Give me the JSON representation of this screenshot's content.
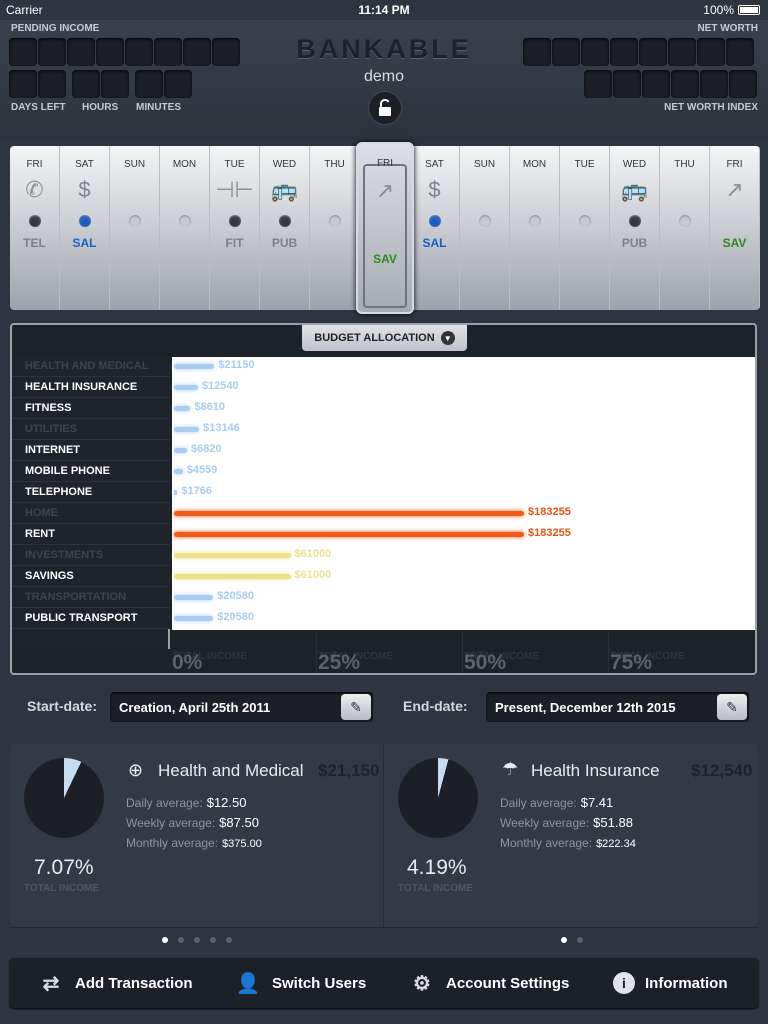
{
  "statusbar": {
    "carrier": "Carrier",
    "time": "11:14 PM",
    "battery": "100%"
  },
  "header": {
    "pending_income_label": "PENDING INCOME",
    "net_worth_label": "NET WORTH",
    "days_left_label": "DAYS LEFT",
    "hours_label": "HOURS",
    "minutes_label": "MINUTES",
    "net_worth_index_label": "NET WORTH INDEX",
    "brand": "BANKABLE",
    "user": "demo"
  },
  "calendar": {
    "days": [
      {
        "name": "FRI",
        "icon": "phone-icon",
        "glyph": "✆",
        "dot": "dark",
        "code": "TEL",
        "code_color": "gray"
      },
      {
        "name": "SAT",
        "icon": "dollar-icon",
        "glyph": "$",
        "dot": "blue",
        "code": "SAL",
        "code_color": "blue"
      },
      {
        "name": "SUN",
        "icon": "",
        "glyph": "",
        "dot": "light",
        "code": "",
        "code_color": "gray"
      },
      {
        "name": "MON",
        "icon": "",
        "glyph": "",
        "dot": "light",
        "code": "",
        "code_color": "gray"
      },
      {
        "name": "TUE",
        "icon": "dumbbell-icon",
        "glyph": "⊣⊢",
        "dot": "dark",
        "code": "FIT",
        "code_color": "gray"
      },
      {
        "name": "WED",
        "icon": "bus-icon",
        "glyph": "🚌",
        "dot": "dark",
        "code": "PUB",
        "code_color": "gray"
      },
      {
        "name": "THU",
        "icon": "",
        "glyph": "",
        "dot": "light",
        "code": "",
        "code_color": "gray"
      },
      {
        "name": "FRI",
        "icon": "trend-up-icon",
        "glyph": "↗",
        "dot": "none",
        "code": "SAV",
        "code_color": "green"
      },
      {
        "name": "SAT",
        "icon": "dollar-icon",
        "glyph": "$",
        "dot": "blue",
        "code": "SAL",
        "code_color": "blue"
      },
      {
        "name": "SUN",
        "icon": "",
        "glyph": "",
        "dot": "light",
        "code": "",
        "code_color": "gray"
      },
      {
        "name": "MON",
        "icon": "",
        "glyph": "",
        "dot": "light",
        "code": "",
        "code_color": "gray"
      },
      {
        "name": "TUE",
        "icon": "",
        "glyph": "",
        "dot": "light",
        "code": "",
        "code_color": "gray"
      },
      {
        "name": "WED",
        "icon": "bus-icon",
        "glyph": "🚌",
        "dot": "dark",
        "code": "PUB",
        "code_color": "gray"
      },
      {
        "name": "THU",
        "icon": "",
        "glyph": "",
        "dot": "light",
        "code": "",
        "code_color": "gray"
      },
      {
        "name": "FRI",
        "icon": "trend-up-icon",
        "glyph": "↗",
        "dot": "none",
        "code": "SAV",
        "code_color": "green"
      }
    ],
    "selected_index": 7
  },
  "budget": {
    "title": "BUDGET ALLOCATION",
    "rows": [
      {
        "label": "HEALTH AND MEDICAL",
        "type": "head",
        "amount": "$21150",
        "value": 21150,
        "color": "#a9cdf0"
      },
      {
        "label": "HEALTH INSURANCE",
        "type": "sub",
        "amount": "$12540",
        "value": 12540,
        "color": "#a9cdf0"
      },
      {
        "label": "FITNESS",
        "type": "sub",
        "amount": "$8610",
        "value": 8610,
        "color": "#a9cdf0"
      },
      {
        "label": "UTILITIES",
        "type": "head",
        "amount": "$13146",
        "value": 13146,
        "color": "#a9cdf0"
      },
      {
        "label": "INTERNET",
        "type": "sub",
        "amount": "$6820",
        "value": 6820,
        "color": "#a9cdf0"
      },
      {
        "label": "MOBILE PHONE",
        "type": "sub",
        "amount": "$4559",
        "value": 4559,
        "color": "#a9cdf0"
      },
      {
        "label": "TELEPHONE",
        "type": "sub",
        "amount": "$1766",
        "value": 1766,
        "color": "#a9cdf0"
      },
      {
        "label": "HOME",
        "type": "head",
        "amount": "$183255",
        "value": 183255,
        "color": "#f05a1a"
      },
      {
        "label": "RENT",
        "type": "sub",
        "amount": "$183255",
        "value": 183255,
        "color": "#f05a1a"
      },
      {
        "label": "INVESTMENTS",
        "type": "head",
        "amount": "$61000",
        "value": 61000,
        "color": "#ede08a"
      },
      {
        "label": "SAVINGS",
        "type": "sub",
        "amount": "$61000",
        "value": 61000,
        "color": "#ede08a"
      },
      {
        "label": "TRANSPORTATION",
        "type": "head",
        "amount": "$20580",
        "value": 20580,
        "color": "#a9cdf0"
      },
      {
        "label": "PUBLIC TRANSPORT",
        "type": "sub",
        "amount": "$20580",
        "value": 20580,
        "color": "#a9cdf0"
      }
    ],
    "axis": [
      {
        "pct": "0%",
        "rest": "TOTAL INCOME"
      },
      {
        "pct": "25%",
        "rest": "TOTAL INCOME"
      },
      {
        "pct": "50%",
        "rest": "TOTAL INCOME"
      },
      {
        "pct": "75%",
        "rest": "TOTAL INCOME"
      }
    ]
  },
  "dates": {
    "start_label": "Start-date:",
    "start_value": "Creation, April 25th 2011",
    "end_label": "End-date:",
    "end_value": "Present, December 12th 2015"
  },
  "cards": [
    {
      "icon": "plus-circle-icon",
      "title": "Health and Medical",
      "amount": "$21,150",
      "daily_label": "Daily average:",
      "daily": "$12.50",
      "weekly_label": "Weekly average:",
      "weekly": "$87.50",
      "monthly_label": "Monthly average:",
      "monthly": "$375.00",
      "percent": "7.07%",
      "percent_value": 7.07,
      "percent_label": "TOTAL INCOME",
      "pages": 5,
      "page": 0
    },
    {
      "icon": "umbrella-icon",
      "title": "Health Insurance",
      "amount": "$12,540",
      "daily_label": "Daily average:",
      "daily": "$7.41",
      "weekly_label": "Weekly average:",
      "weekly": "$51.88",
      "monthly_label": "Monthly average:",
      "monthly": "$222.34",
      "percent": "4.19%",
      "percent_value": 4.19,
      "percent_label": "TOTAL INCOME",
      "pages": 2,
      "page": 0
    }
  ],
  "toolbar": {
    "add": "Add Transaction",
    "switch": "Switch Users",
    "settings": "Account Settings",
    "info": "Information"
  },
  "colors": {
    "background": "#2f3540",
    "accent_blue": "#1b5fc7",
    "accent_green": "#2a8a1c",
    "bar_home": "#f05a1a",
    "bar_invest": "#ede08a",
    "bar_default": "#a9cdf0"
  }
}
